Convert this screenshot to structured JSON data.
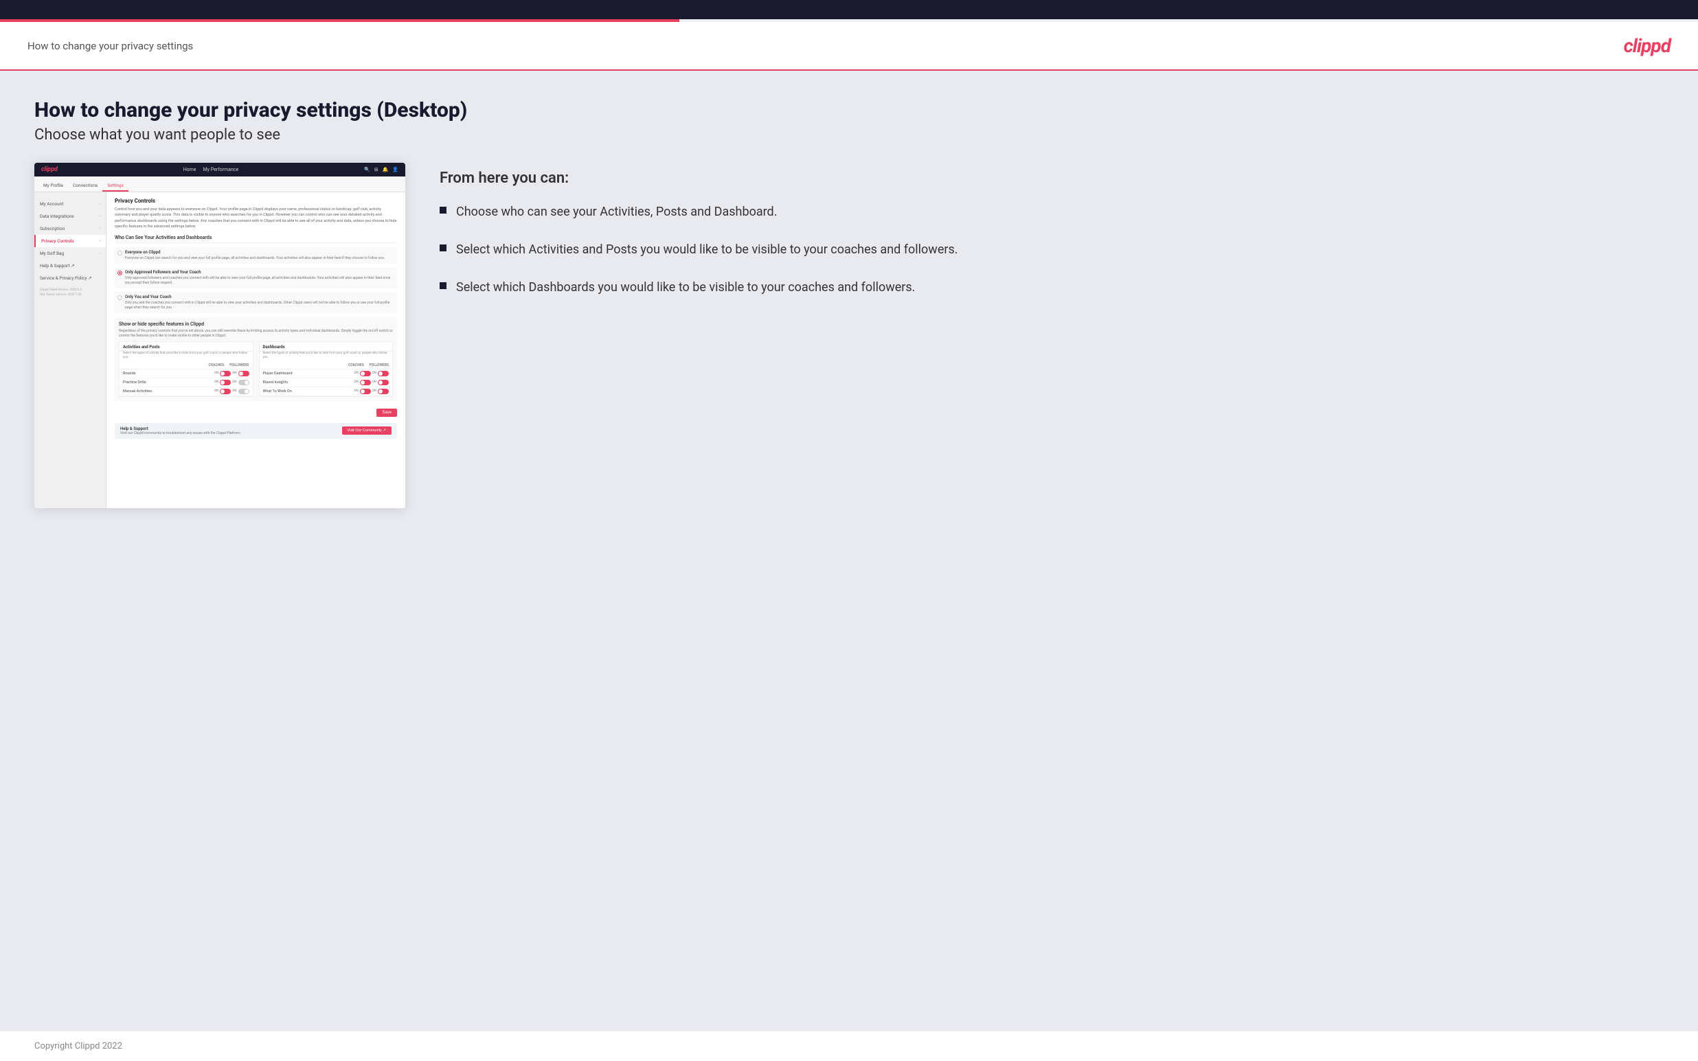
{
  "topbar": {},
  "header": {
    "title": "How to change your privacy settings",
    "logo": "clippd"
  },
  "main": {
    "heading": "How to change your privacy settings (Desktop)",
    "subheading": "Choose what you want people to see",
    "right_panel": {
      "from_here": "From here you can:",
      "bullets": [
        "Choose who can see your Activities, Posts and Dashboard.",
        "Select which Activities and Posts you would like to be visible to your coaches and followers.",
        "Select which Dashboards you would like to be visible to your coaches and followers."
      ]
    },
    "mockup": {
      "nav": {
        "logo": "clippd",
        "links": [
          "Home",
          "My Performance"
        ],
        "icons": [
          "search",
          "grid",
          "bell",
          "avatar"
        ]
      },
      "tabs": [
        "My Profile",
        "Connections",
        "Settings"
      ],
      "sidebar": {
        "items": [
          {
            "label": "My Account",
            "active": false
          },
          {
            "label": "Data Integrations",
            "active": false
          },
          {
            "label": "Subscription",
            "active": false
          },
          {
            "label": "Privacy Controls",
            "active": true
          },
          {
            "label": "My Golf Bag",
            "active": false
          },
          {
            "label": "Help & Support",
            "active": false,
            "external": true
          },
          {
            "label": "Service & Privacy Policy",
            "active": false,
            "external": true
          }
        ],
        "version": "Clippd Client Version: 2022.8.2\nSQL Server Version: 2022.7.30"
      },
      "main": {
        "privacy_controls": {
          "title": "Privacy Controls",
          "desc": "Control how you and your data appears to everyone on Clippd. Your profile page in Clippd displays your name, professional status or handicap, golf club, activity summary and player quality score. This data is visible to anyone who searches for you in Clippd. However you can control who can see your detailed activity and performance dashboards using the settings below. Any coaches that you connect with in Clippd will be able to see all of your activity and data, unless you choose to hide specific features in the advanced settings below.",
          "visibility_title": "Who Can See Your Activities and Dashboards",
          "options": [
            {
              "label": "Everyone on Clippd",
              "desc": "Everyone on Clippd can search for you and view your full profile page, all activities and dashboards. Your activities will also appear in their feed if they choose to follow you.",
              "selected": false
            },
            {
              "label": "Only Approved Followers and Your Coach",
              "desc": "Only approved followers and coaches you connect with will be able to view your full profile page, all activities and dashboards. Your activities will also appear in their feed once you accept their follow request.",
              "selected": true
            },
            {
              "label": "Only You and Your Coach",
              "desc": "Only you and the coaches you connect with in Clippd will be able to view your activities and dashboards. Other Clippd users will not be able to follow you or see your full profile page when they search for you.",
              "selected": false
            }
          ],
          "show_hide_title": "Show or hide specific features in Clippd",
          "show_hide_desc": "Regardless of the privacy controls that you've set above, you can still override these by limiting access to activity types and individual dashboards. Simply toggle the on/off switch to control the features you'd like to make visible to other people in Clippd.",
          "activities_posts": {
            "title": "Activities and Posts",
            "desc": "Select the types of activity that you'd like to hide from your golf coach or people who follow you.",
            "cols": [
              "COACHES",
              "FOLLOWERS"
            ],
            "rows": [
              {
                "label": "Rounds",
                "coaches_on": true,
                "followers_on": true
              },
              {
                "label": "Practice Drills",
                "coaches_on": true,
                "followers_on": false
              },
              {
                "label": "Manual Activities",
                "coaches_on": true,
                "followers_on": false
              }
            ]
          },
          "dashboards": {
            "title": "Dashboards",
            "desc": "Select the types of activity that you'd like to hide from your golf coach or people who follow you.",
            "cols": [
              "COACHES",
              "FOLLOWERS"
            ],
            "rows": [
              {
                "label": "Player Dashboard",
                "coaches_on": true,
                "followers_on": true
              },
              {
                "label": "Round Insights",
                "coaches_on": true,
                "followers_on": true
              },
              {
                "label": "What To Work On",
                "coaches_on": true,
                "followers_on": true
              }
            ]
          },
          "save_label": "Save",
          "help_section": {
            "title": "Help & Support",
            "desc": "Visit our Clippd community to troubleshoot any issues with the Clippd Platform.",
            "visit_label": "Visit Our Community"
          }
        }
      }
    }
  },
  "footer": {
    "text": "Copyright Clippd 2022"
  }
}
